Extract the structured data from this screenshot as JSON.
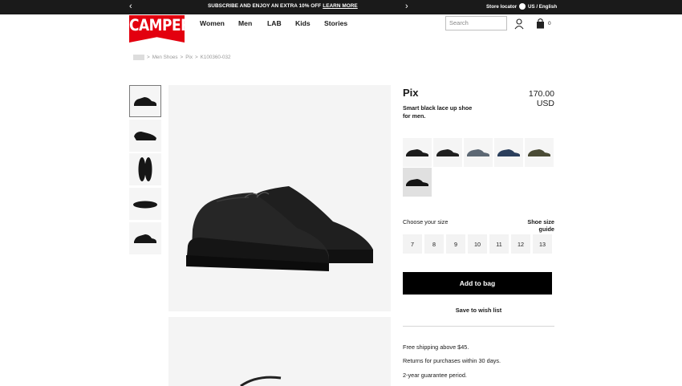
{
  "promo": {
    "message": "SUBSCRIBE AND ENJOY AN EXTRA 10% OFF",
    "link": "LEARN MORE",
    "store_locator": "Store locator",
    "language": "US / English"
  },
  "header": {
    "logo": "CAMPER",
    "nav": [
      "Women",
      "Men",
      "LAB",
      "Kids",
      "Stories"
    ],
    "search_placeholder": "Search",
    "bag_count": "0"
  },
  "breadcrumb": {
    "items": [
      "Men Shoes",
      "Pix",
      "K100360-032"
    ],
    "separator": ">"
  },
  "product": {
    "title": "Pix",
    "price": "170.00 USD",
    "description": "Smart black lace up shoe for men.",
    "swatch_colors": [
      "#1c1c1c",
      "#202020",
      "#5d6874",
      "#2b3f5c",
      "#4a4b35",
      "#141414"
    ],
    "size_label": "Choose your size",
    "size_guide": "Shoe size guide",
    "sizes": [
      "7",
      "8",
      "9",
      "10",
      "11",
      "12",
      "13"
    ],
    "add_to_bag": "Add to bag",
    "wishlist": "Save to wish list",
    "info": [
      "Free shipping above $45.",
      "Returns for purchases within 30 days.",
      "2-year guarantee period."
    ]
  },
  "colors": {
    "brand": "#e3000f",
    "bar": "#1a1a1a"
  }
}
